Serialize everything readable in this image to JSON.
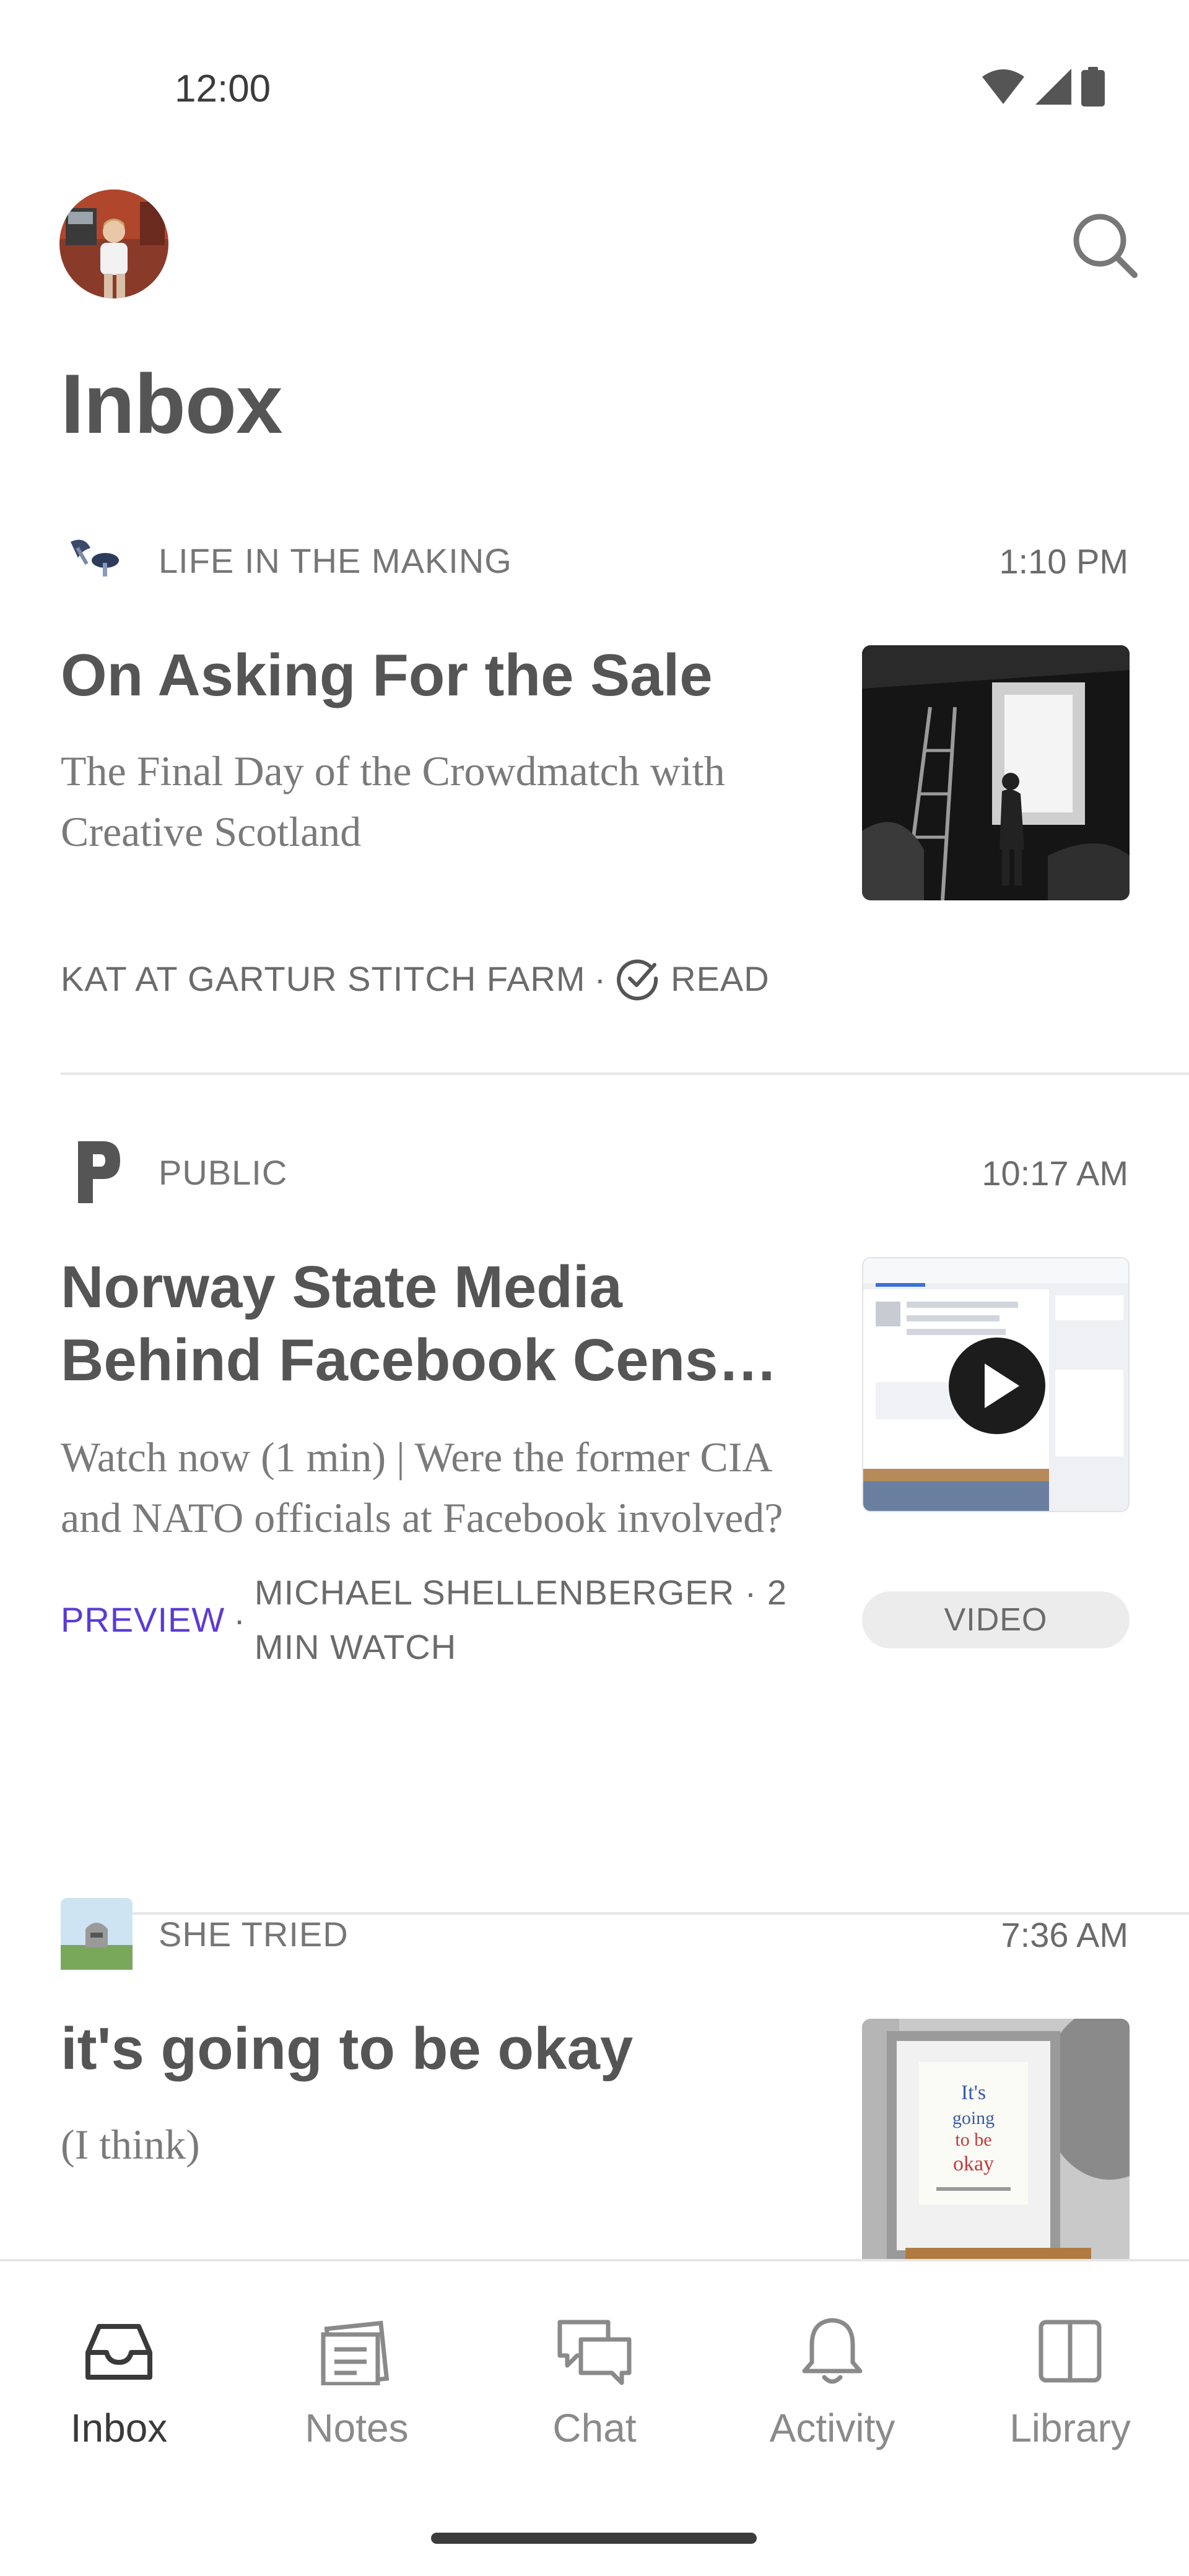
{
  "status_bar": {
    "time": "12:00"
  },
  "header": {
    "title": "Inbox",
    "search_icon": "search-icon",
    "avatar_icon": "avatar"
  },
  "posts": [
    {
      "publication": "LIFE IN THE MAKING",
      "time": "1:10 PM",
      "title": "On Asking For the Sale",
      "subtitle": "The Final Day of the Crowdmatch with Creative Scotland",
      "author": "KAT AT GARTUR STITCH FARM",
      "separator": "·",
      "status": "READ"
    },
    {
      "publication": "PUBLIC",
      "time": "10:17 AM",
      "title": "Norway State Media Behind Facebook Cens…",
      "subtitle": "Watch now (1 min) | Were the former CIA and NATO officials at Facebook involved?",
      "preview_label": "PREVIEW",
      "separator": "·",
      "author_line": "MICHAEL SHELLENBERGER · 2 MIN WATCH",
      "badge": "VIDEO"
    },
    {
      "publication": "SHE TRIED",
      "time": "7:36 AM",
      "title": "it's going to be okay",
      "subtitle": "(I think)"
    }
  ],
  "bottom_nav": [
    {
      "label": "Inbox",
      "icon": "inbox-icon",
      "active": true
    },
    {
      "label": "Notes",
      "icon": "notes-icon",
      "active": false
    },
    {
      "label": "Chat",
      "icon": "chat-icon",
      "active": false
    },
    {
      "label": "Activity",
      "icon": "bell-icon",
      "active": false
    },
    {
      "label": "Library",
      "icon": "library-icon",
      "active": false
    }
  ],
  "colors": {
    "accent": "#5b3bd6",
    "text": "#555555",
    "muted": "#767676",
    "divider": "#e6e6e6"
  }
}
